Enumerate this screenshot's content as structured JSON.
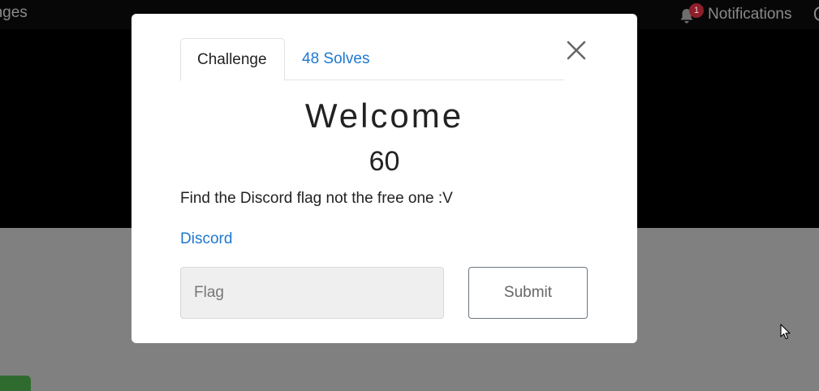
{
  "navbar": {
    "left_link": "enges",
    "notifications": {
      "label": "Notifications",
      "badge_count": "1",
      "icon": "bell-icon"
    }
  },
  "modal": {
    "tabs": [
      {
        "label": "Challenge",
        "active": true
      },
      {
        "label": "48 Solves",
        "active": false
      }
    ],
    "close_icon": "close-icon",
    "challenge_name": "Welcome",
    "challenge_value": "60",
    "description": "Find the Discord flag not the free one :V",
    "link_text": "Discord",
    "flag_input": {
      "value": "",
      "placeholder": "Flag"
    },
    "submit_label": "Submit"
  },
  "colors": {
    "link": "#1e78d0",
    "badge": "#8d1f2b",
    "overlay": "#808080",
    "navbar": "#070707"
  }
}
